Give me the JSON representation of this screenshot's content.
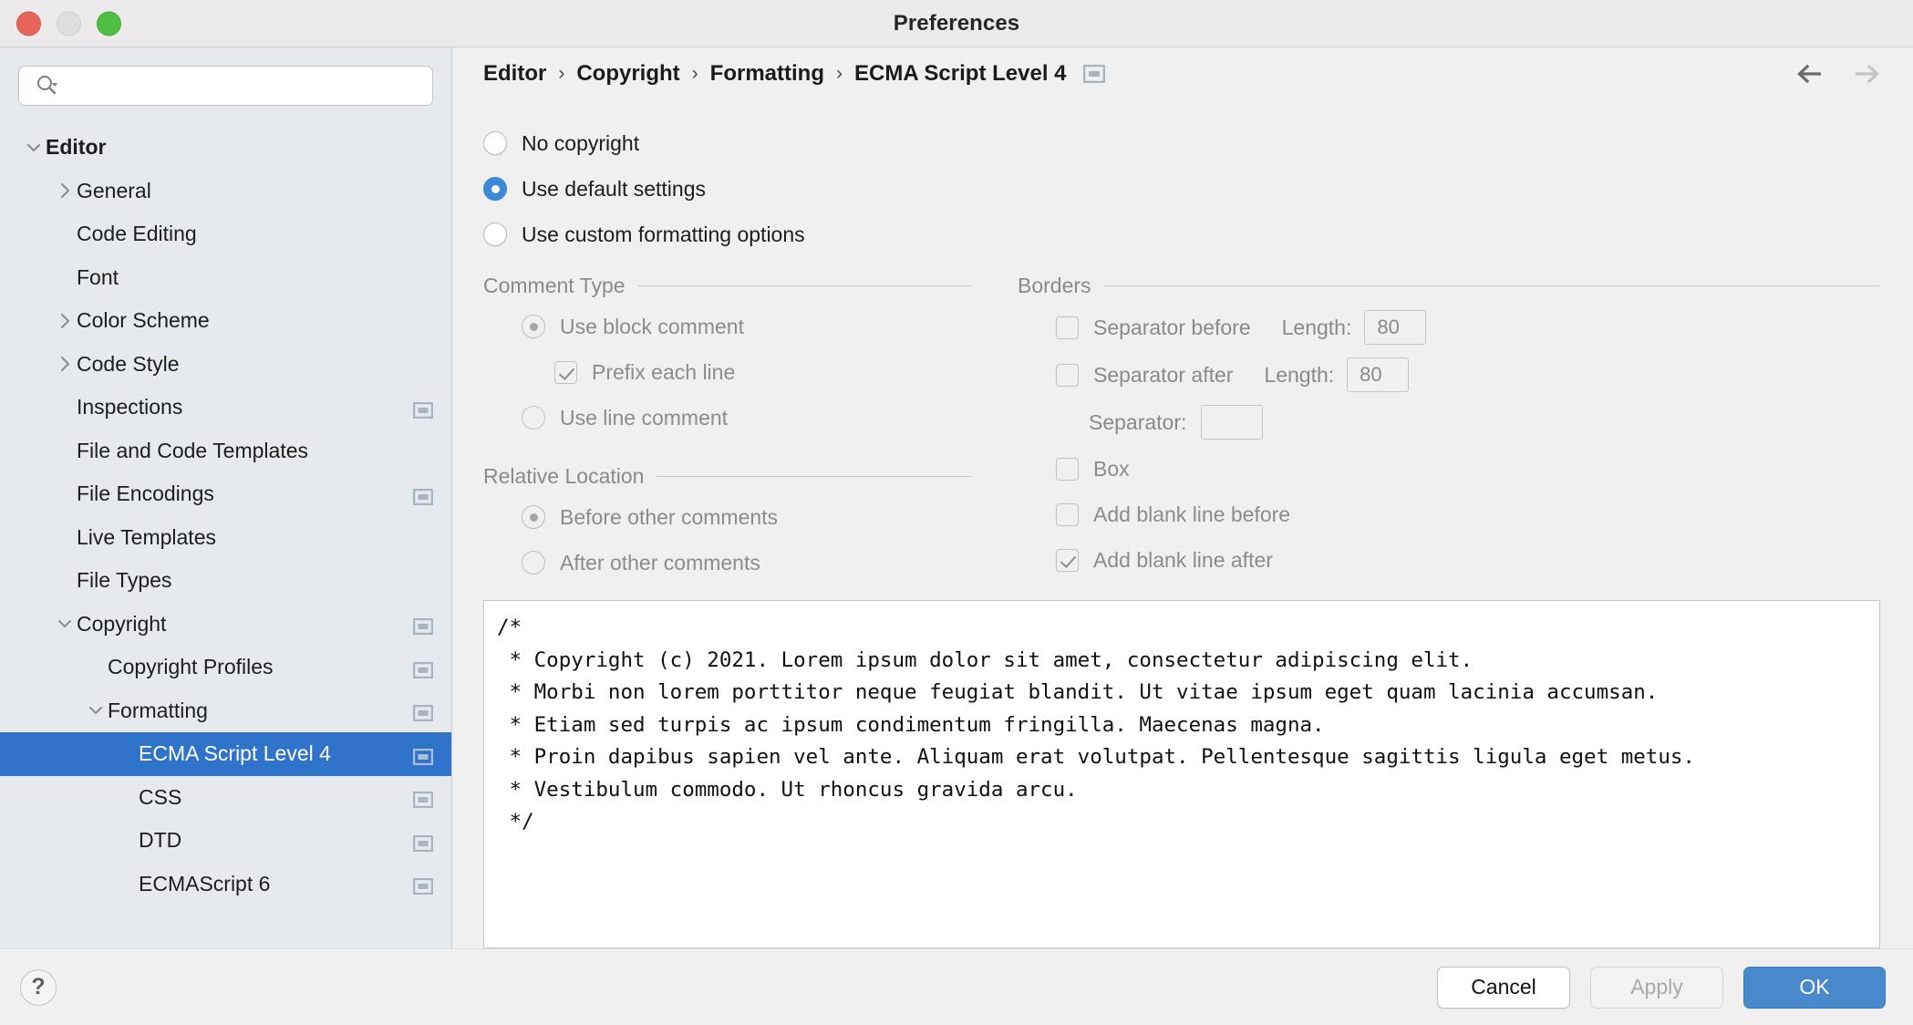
{
  "window": {
    "title": "Preferences",
    "traffic_lights": [
      "close-button",
      "minimize-button",
      "zoom-button"
    ]
  },
  "search": {
    "placeholder": "",
    "value": ""
  },
  "sidebar": {
    "items": [
      {
        "label": "Editor",
        "level": 0,
        "twisty": "down",
        "bold": true,
        "badge": false,
        "selected": false
      },
      {
        "label": "General",
        "level": 1,
        "twisty": "right",
        "bold": false,
        "badge": false,
        "selected": false
      },
      {
        "label": "Code Editing",
        "level": 1,
        "twisty": "none",
        "bold": false,
        "badge": false,
        "selected": false
      },
      {
        "label": "Font",
        "level": 1,
        "twisty": "none",
        "bold": false,
        "badge": false,
        "selected": false
      },
      {
        "label": "Color Scheme",
        "level": 1,
        "twisty": "right",
        "bold": false,
        "badge": false,
        "selected": false
      },
      {
        "label": "Code Style",
        "level": 1,
        "twisty": "right",
        "bold": false,
        "badge": false,
        "selected": false
      },
      {
        "label": "Inspections",
        "level": 1,
        "twisty": "none",
        "bold": false,
        "badge": true,
        "selected": false
      },
      {
        "label": "File and Code Templates",
        "level": 1,
        "twisty": "none",
        "bold": false,
        "badge": false,
        "selected": false
      },
      {
        "label": "File Encodings",
        "level": 1,
        "twisty": "none",
        "bold": false,
        "badge": true,
        "selected": false
      },
      {
        "label": "Live Templates",
        "level": 1,
        "twisty": "none",
        "bold": false,
        "badge": false,
        "selected": false
      },
      {
        "label": "File Types",
        "level": 1,
        "twisty": "none",
        "bold": false,
        "badge": false,
        "selected": false
      },
      {
        "label": "Copyright",
        "level": 1,
        "twisty": "down",
        "bold": false,
        "badge": true,
        "selected": false
      },
      {
        "label": "Copyright Profiles",
        "level": 2,
        "twisty": "none",
        "bold": false,
        "badge": true,
        "selected": false
      },
      {
        "label": "Formatting",
        "level": 2,
        "twisty": "down",
        "bold": false,
        "badge": true,
        "selected": false
      },
      {
        "label": "ECMA Script Level 4",
        "level": 3,
        "twisty": "none",
        "bold": false,
        "badge": true,
        "selected": true
      },
      {
        "label": "CSS",
        "level": 3,
        "twisty": "none",
        "bold": false,
        "badge": true,
        "selected": false
      },
      {
        "label": "DTD",
        "level": 3,
        "twisty": "none",
        "bold": false,
        "badge": true,
        "selected": false
      },
      {
        "label": "ECMAScript 6",
        "level": 3,
        "twisty": "none",
        "bold": false,
        "badge": true,
        "selected": false
      }
    ]
  },
  "breadcrumb": {
    "separator": "›",
    "items": [
      "Editor",
      "Copyright",
      "Formatting",
      "ECMA Script Level 4"
    ],
    "badge_icon": "project-scope-icon",
    "back_icon": "arrow-left-icon",
    "forward_icon": "arrow-right-icon"
  },
  "copyright_mode": {
    "options": [
      {
        "label": "No copyright",
        "checked": false
      },
      {
        "label": "Use default settings",
        "checked": true
      },
      {
        "label": "Use custom formatting options",
        "checked": false
      }
    ]
  },
  "comment_type": {
    "title": "Comment Type",
    "use_block_comment": {
      "label": "Use block comment",
      "checked": true,
      "disabled": true
    },
    "prefix_each_line": {
      "label": "Prefix each line",
      "checked": true,
      "disabled": true
    },
    "use_line_comment": {
      "label": "Use line comment",
      "checked": false,
      "disabled": true
    }
  },
  "relative_location": {
    "title": "Relative Location",
    "before": {
      "label": "Before other comments",
      "checked": true,
      "disabled": true
    },
    "after": {
      "label": "After other comments",
      "checked": false,
      "disabled": true
    }
  },
  "borders": {
    "title": "Borders",
    "separator_before": {
      "label": "Separator before",
      "checked": false,
      "disabled": true
    },
    "separator_after": {
      "label": "Separator after",
      "checked": false,
      "disabled": true
    },
    "length_label": "Length:",
    "length_before_value": "80",
    "length_after_value": "80",
    "separator_label": "Separator:",
    "separator_value": "",
    "box": {
      "label": "Box",
      "checked": false,
      "disabled": true
    },
    "add_blank_before": {
      "label": "Add blank line before",
      "checked": false,
      "disabled": true
    },
    "add_blank_after": {
      "label": "Add blank line after",
      "checked": true,
      "disabled": true
    }
  },
  "preview": {
    "text": "/*\n * Copyright (c) 2021. Lorem ipsum dolor sit amet, consectetur adipiscing elit.\n * Morbi non lorem porttitor neque feugiat blandit. Ut vitae ipsum eget quam lacinia accumsan.\n * Etiam sed turpis ac ipsum condimentum fringilla. Maecenas magna.\n * Proin dapibus sapien vel ante. Aliquam erat volutpat. Pellentesque sagittis ligula eget metus.\n * Vestibulum commodo. Ut rhoncus gravida arcu.\n */"
  },
  "footer": {
    "help_label": "?",
    "cancel_label": "Cancel",
    "apply_label": "Apply",
    "apply_disabled": true,
    "ok_label": "OK"
  },
  "colors": {
    "selection_blue": "#2f73ca",
    "accent_blue": "#3b8ad9",
    "primary_button": "#4a88cc",
    "sidebar_bg": "#e6eaee",
    "panel_bg": "#f0f0f0",
    "disabled_text": "#8a8a8a"
  }
}
